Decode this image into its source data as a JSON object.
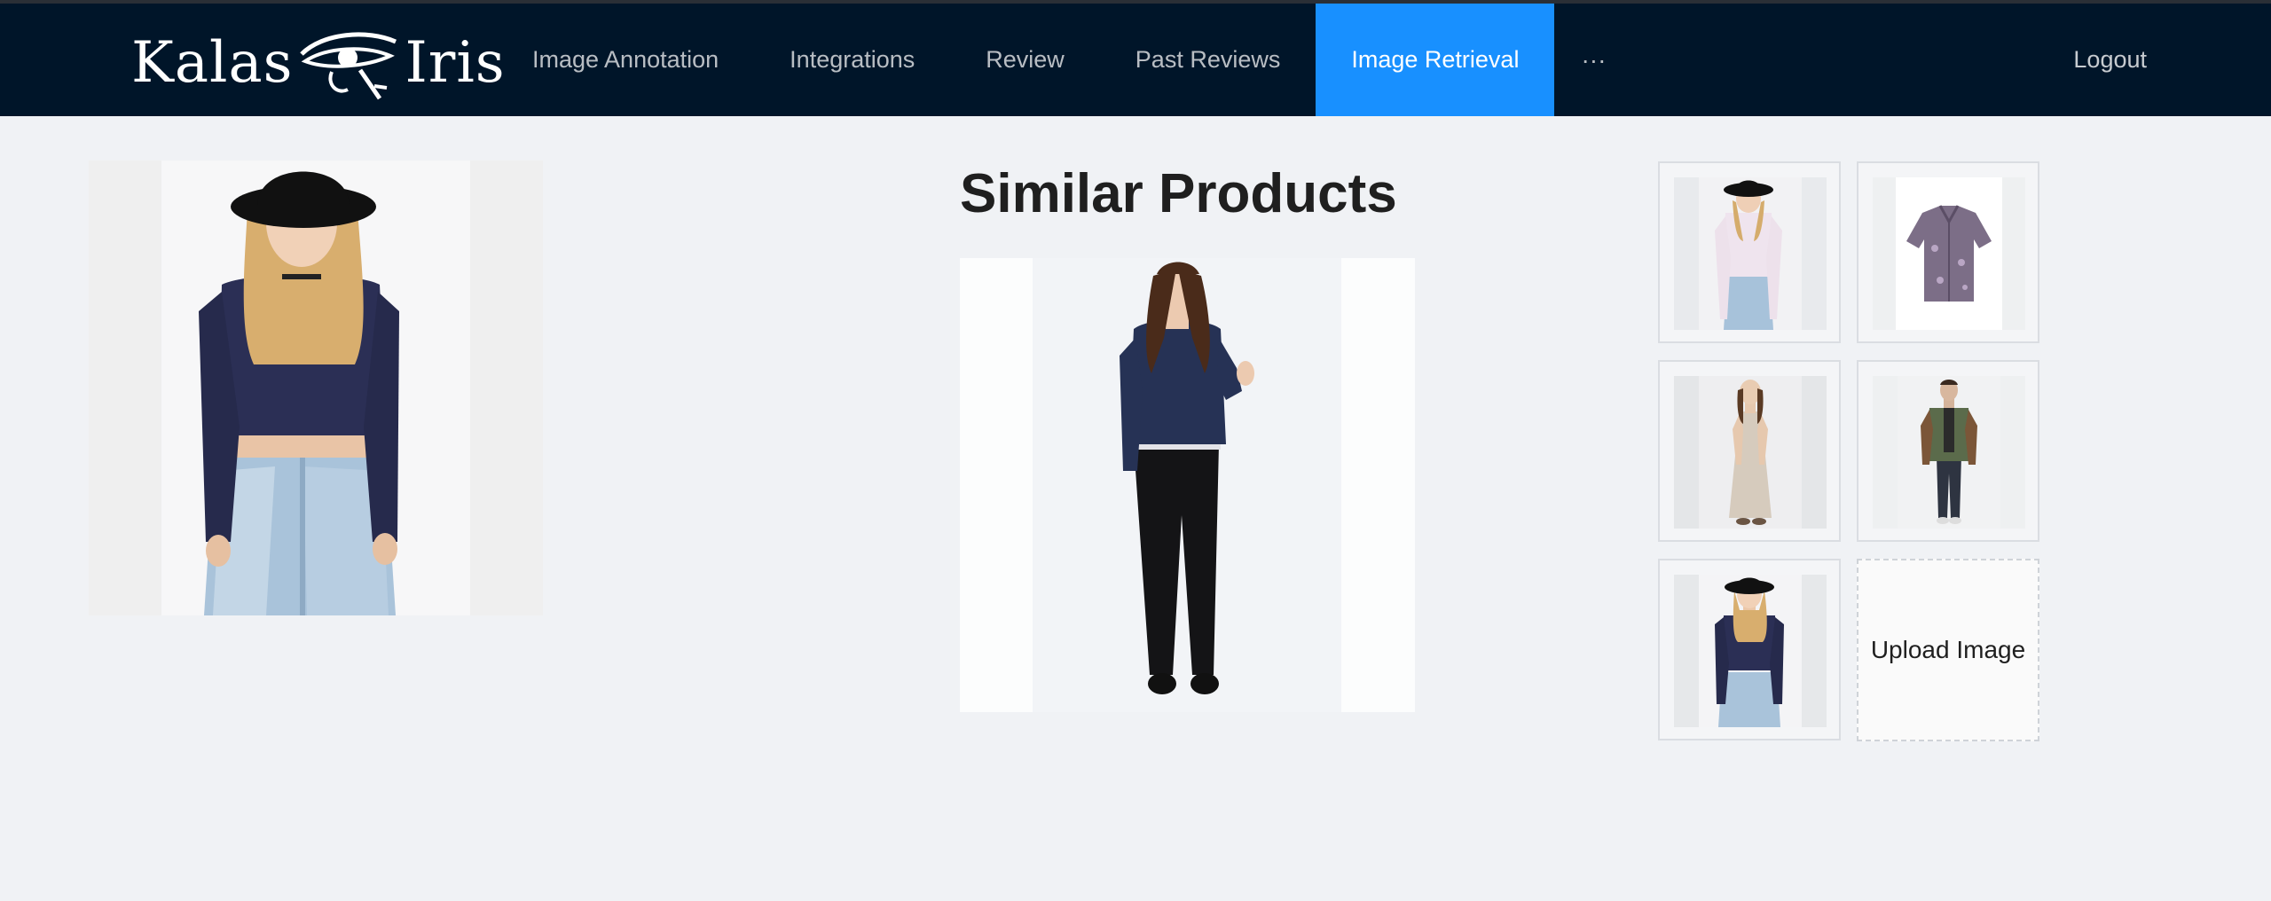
{
  "app": {
    "logo_left": "Kalas",
    "logo_right": "Iris",
    "logo_icon": "eye-of-horus-icon"
  },
  "nav": {
    "items": [
      {
        "label": "Image Annotation"
      },
      {
        "label": "Integrations"
      },
      {
        "label": "Review"
      },
      {
        "label": "Past Reviews"
      },
      {
        "label": "Image Retrieval"
      },
      {
        "label": "···"
      }
    ],
    "active_index": 4,
    "logout_label": "Logout"
  },
  "main": {
    "results_title": "Similar Products",
    "upload_label": "Upload Image"
  },
  "colors": {
    "header_bg": "#001529",
    "active_tab": "#1890ff",
    "page_bg": "#f0f2f5"
  }
}
